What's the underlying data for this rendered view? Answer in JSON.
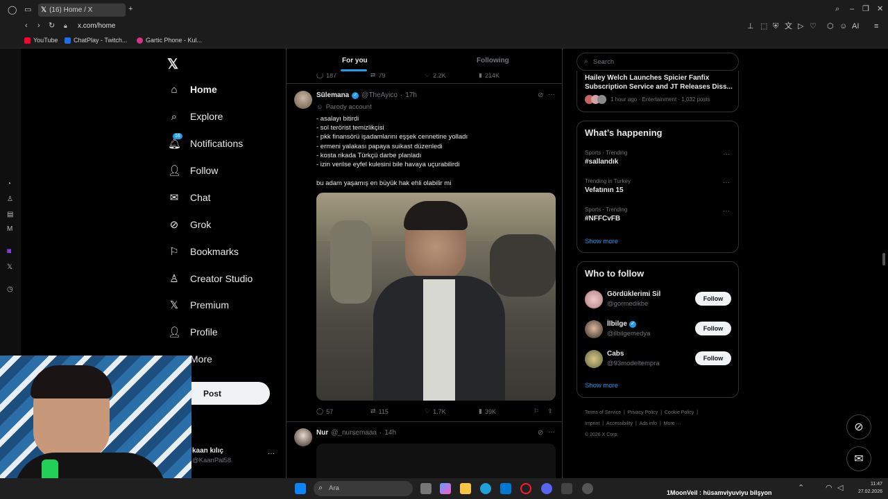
{
  "browser": {
    "tab_title": "(16) Home / X",
    "url": "x.com/home",
    "bookmarks": [
      "YouTube",
      "ChatPlay - Twitch...",
      "Gartic Phone - Kul..."
    ],
    "bookmark_colors": [
      "#ff0033",
      "#1f6feb",
      "#d63384"
    ]
  },
  "nav": {
    "home": "Home",
    "explore": "Explore",
    "notifications": "Notifications",
    "notifications_badge": "16",
    "follow": "Follow",
    "chat": "Chat",
    "grok": "Grok",
    "bookmarks": "Bookmarks",
    "creator_studio": "Creator Studio",
    "premium": "Premium",
    "profile": "Profile",
    "more": "More",
    "post": "Post"
  },
  "account": {
    "name": "kaan kılıç",
    "handle": "@KaanPal58"
  },
  "timeline": {
    "tabs": [
      "For you",
      "Following"
    ],
    "prev_stats": [
      "187",
      "79",
      "2.2K",
      "214K"
    ],
    "tweet1": {
      "author": "Sülemana",
      "handle": "@TheAyico",
      "time": "17h",
      "parody": "Parody account",
      "lines": [
        "- asalayı bitirdi",
        "- sol terörist temizlikçisi",
        "- pkk finansörü işadamlarını eşşek cennetine yolladı",
        "- ermeni yalakası papaya suikast düzenledi",
        "- kosta rikada Türkçü darbe planladı",
        "- izin verilse eyfel kulesini bile havaya uçurabilirdi"
      ],
      "closing": "bu adam yaşamış en büyük hak ehli olabilir mi",
      "stats": [
        "57",
        "115",
        "1.7K",
        "39K"
      ]
    },
    "tweet2": {
      "author": "Nur",
      "handle": "@_nursemaaa",
      "time": "14h"
    }
  },
  "sidebar": {
    "search_placeholder": "Search",
    "news_title": "Hailey Welch Launches Spicier Fanfix Subscription Service and JT Releases Diss...",
    "news_meta": "1 hour ago · Entertainment · 1,032 posts",
    "happening_title": "What’s happening",
    "trends": [
      {
        "category": "Sports · Trending",
        "name": "#sallandık"
      },
      {
        "category": "Trending in Turkey",
        "name": "Vefatının 15"
      },
      {
        "category": "Sports · Trending",
        "name": "#NFFCvFB"
      }
    ],
    "show_more": "Show more",
    "wtf_title": "Who to follow",
    "follows": [
      {
        "name": "Gördüklerimi Sil",
        "handle": "@gormedikbe",
        "button": "Follow"
      },
      {
        "name": "İlbilge",
        "handle": "@ilbilgemedya",
        "button": "Follow"
      },
      {
        "name": "Cabs",
        "handle": "@93modeltempra",
        "button": "Follow"
      }
    ],
    "footer": [
      "Terms of Service",
      "|",
      "Privacy Policy",
      "|",
      "Cookie Policy",
      "|",
      "Imprint",
      "|",
      "Accessibility",
      "|",
      "Ads info",
      "|",
      "More ···",
      "© 2026 X Corp."
    ]
  },
  "taskbar": {
    "search": "Ara",
    "now_playing": "1MoonVeil : hüsamviyuviyu bilşyon",
    "time": "11:47",
    "date": "27.02.2026"
  },
  "colors": {
    "accent": "#1d9bf0",
    "background": "#000000",
    "border": "#2f3336"
  }
}
